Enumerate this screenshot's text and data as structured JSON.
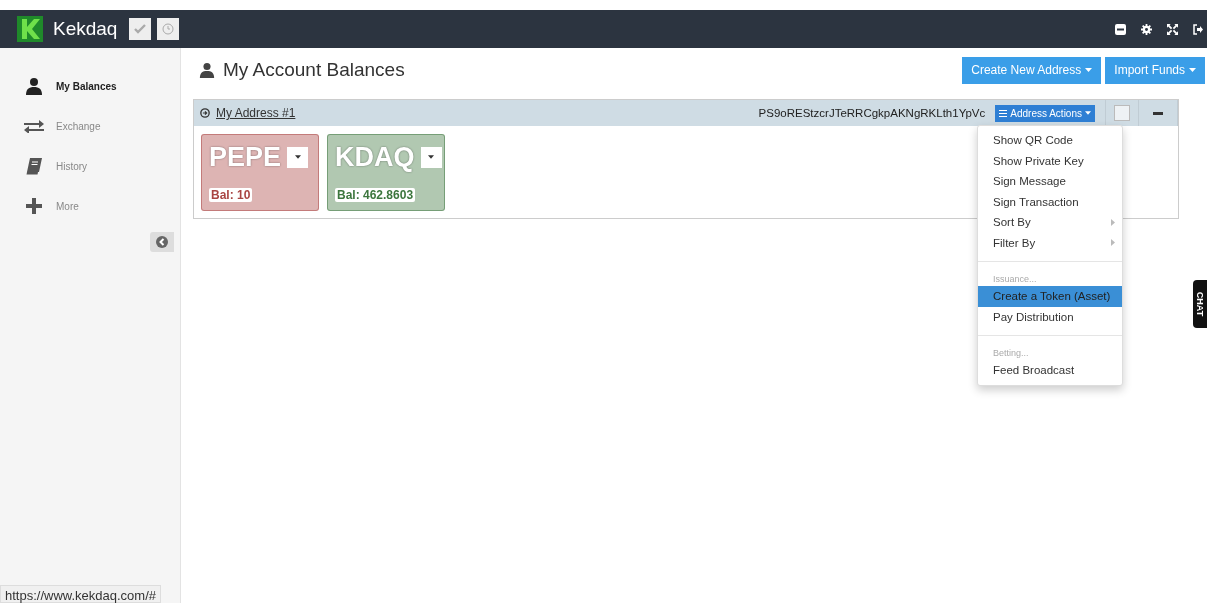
{
  "header": {
    "brand": "Kekdaq"
  },
  "sidebar": {
    "items": [
      {
        "label": "My Balances",
        "selected": true
      },
      {
        "label": "Exchange",
        "selected": false
      },
      {
        "label": "History",
        "selected": false
      },
      {
        "label": "More",
        "selected": false
      }
    ]
  },
  "page": {
    "title": "My Account Balances",
    "buttons": [
      "Create New Address",
      "Import Funds"
    ]
  },
  "address": {
    "name": "My Address #1",
    "key": "PS9oREStzcrJTeRRCgkpAKNgRKLth1YpVc",
    "actions_button": "Address Actions",
    "checked": false,
    "tokens": [
      {
        "symbol": "PEPE",
        "balance": "Bal: 10",
        "color": "#a94442"
      },
      {
        "symbol": "KDAQ",
        "balance": "Bal: 462.8603",
        "color": "#3c763d"
      }
    ]
  },
  "menu": {
    "items": [
      {
        "kind": "item",
        "label": "Show QR Code",
        "selected": false
      },
      {
        "kind": "item",
        "label": "Show Private Key",
        "selected": false
      },
      {
        "kind": "item",
        "label": "Sign Message",
        "selected": false
      },
      {
        "kind": "item",
        "label": "Sign Transaction",
        "selected": false
      },
      {
        "kind": "submenu",
        "label": "Sort By",
        "selected": false
      },
      {
        "kind": "submenu",
        "label": "Filter By",
        "selected": false
      },
      {
        "kind": "divider"
      },
      {
        "kind": "header",
        "label": "Issuance..."
      },
      {
        "kind": "item",
        "label": "Create a Token (Asset)",
        "selected": true
      },
      {
        "kind": "item",
        "label": "Pay Distribution",
        "selected": false
      },
      {
        "kind": "divider"
      },
      {
        "kind": "header",
        "label": "Betting..."
      },
      {
        "kind": "item",
        "label": "Feed Broadcast",
        "selected": false
      }
    ]
  },
  "chat_tab": "CHAT",
  "status_url": "https://www.kekdaq.com/#"
}
